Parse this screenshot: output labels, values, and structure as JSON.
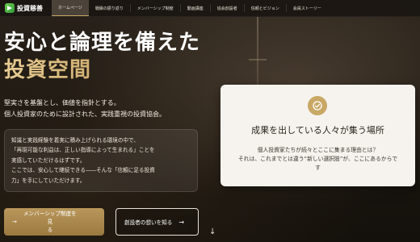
{
  "nav": {
    "brand": "投資慈善",
    "items": [
      {
        "label": "ホームページ",
        "active": true
      },
      {
        "label": "戦績の振り返り",
        "active": false
      },
      {
        "label": "メンバーシップ制度",
        "active": false
      },
      {
        "label": "動画講座",
        "active": false
      },
      {
        "label": "協会創設者",
        "active": false
      },
      {
        "label": "信頼とビジョン",
        "active": false
      },
      {
        "label": "会員ストーリー",
        "active": false
      }
    ]
  },
  "hero": {
    "title_line1": "安心と論理を備えた",
    "title_line2": "投資空間",
    "lead": [
      "堅実さを基盤とし、価値を指針とする。",
      "個人投資家のために設計された、実践重視の投資協会。"
    ],
    "quote": [
      "知識と実践経験を着実に積み上げられる環境の中で、",
      "「再現可能な利益は、正しい指導によって生まれる」ことを",
      "実感していただけるはずです。",
      "ここでは、安心して継続できる――そんな「信頼に足る投資",
      "力」を手にしていただけます。"
    ],
    "primary_button": {
      "line1": "メンバーシップ制度を見",
      "line2": "る"
    },
    "secondary_button": "創設者の想いを知る"
  },
  "card": {
    "title": "成果を出している人々が集う場所",
    "text": [
      "個人投資家たちが続々とここに集まる理由とは？",
      "それは、これまでとは違う“新しい選択肢”が、ここにあるからで",
      "す"
    ]
  },
  "colors": {
    "accent_gold": "#c9a866",
    "button_gold": "#b9975b",
    "brand_green": "#4cb446",
    "card_bg": "#f6f3ee"
  }
}
